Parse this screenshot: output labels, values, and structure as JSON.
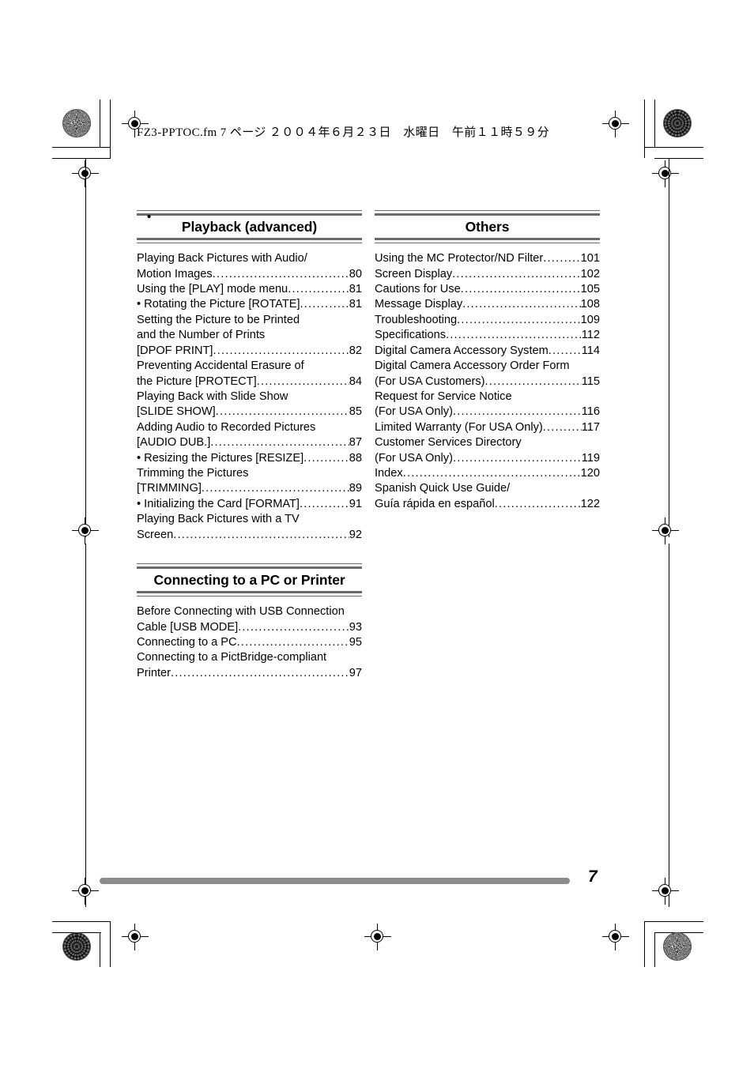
{
  "document": {
    "running_header": "FZ3-PPTOC.fm  7 ページ  ２００４年６月２３日　水曜日　午前１１時５９分",
    "folio": "7"
  },
  "columns": {
    "left": [
      {
        "heading": "Playback (advanced)",
        "entries": [
          {
            "kind": "wrap-start",
            "text": "Playing Back Pictures with Audio/"
          },
          {
            "kind": "entry",
            "indent": "ind",
            "text": "Motion Images",
            "page": "80"
          },
          {
            "kind": "entry",
            "indent": "",
            "text": "Using the [PLAY] mode menu ",
            "page": "81"
          },
          {
            "kind": "entry",
            "indent": "bul",
            "bullet": "•",
            "text": "Rotating the Picture [ROTATE]",
            "page": "81"
          },
          {
            "kind": "wrap-start-bullet",
            "bullet": "•",
            "text": "Setting the Picture to be Printed"
          },
          {
            "kind": "wrap-cont",
            "indent": "bul2",
            "text": "and the Number of Prints"
          },
          {
            "kind": "entry",
            "indent": "bul2",
            "text": "[DPOF PRINT]",
            "page": "82"
          },
          {
            "kind": "wrap-start-bullet",
            "bullet": "•",
            "text": "Preventing Accidental Erasure of"
          },
          {
            "kind": "entry",
            "indent": "bul2",
            "text": "the Picture [PROTECT] ",
            "page": "84"
          },
          {
            "kind": "wrap-start-bullet",
            "bullet": "•",
            "text": "Playing Back with Slide Show"
          },
          {
            "kind": "entry",
            "indent": "bul2",
            "text": "[SLIDE SHOW]",
            "page": "85"
          },
          {
            "kind": "wrap-start-bullet",
            "bullet": "•",
            "text": "Adding Audio to Recorded Pictures"
          },
          {
            "kind": "entry",
            "indent": "bul2",
            "text": "[AUDIO DUB.] ",
            "page": "87"
          },
          {
            "kind": "entry",
            "indent": "bul",
            "bullet": "•",
            "text": "Resizing the Pictures [RESIZE]",
            "page": "88"
          },
          {
            "kind": "wrap-start-bullet",
            "bullet": "•",
            "text": "Trimming the Pictures"
          },
          {
            "kind": "entry",
            "indent": "bul2",
            "text": "[TRIMMING] ",
            "page": "89"
          },
          {
            "kind": "entry",
            "indent": "bul",
            "bullet": "•",
            "text": "Initializing the Card [FORMAT]",
            "page": "91"
          },
          {
            "kind": "wrap-start",
            "text": "Playing Back Pictures with a TV"
          },
          {
            "kind": "entry",
            "indent": "ind",
            "text": "Screen",
            "page": "92"
          }
        ]
      },
      {
        "heading": "Connecting to a PC or Printer",
        "entries": [
          {
            "kind": "wrap-start",
            "text": "Before Connecting with USB Connection"
          },
          {
            "kind": "entry",
            "indent": "ind",
            "text": "Cable [USB MODE]",
            "page": "93"
          },
          {
            "kind": "entry",
            "indent": "",
            "text": "Connecting to a PC",
            "page": "95"
          },
          {
            "kind": "wrap-start",
            "text": "Connecting to a PictBridge-compliant"
          },
          {
            "kind": "entry",
            "indent": "ind",
            "text": "Printer",
            "page": "97"
          }
        ]
      }
    ],
    "right": [
      {
        "heading": "Others",
        "entries": [
          {
            "kind": "entry",
            "indent": "",
            "text": "Using the MC Protector/ND Filter ",
            "page": "101"
          },
          {
            "kind": "entry",
            "indent": "",
            "text": "Screen Display",
            "page": "102"
          },
          {
            "kind": "entry",
            "indent": "",
            "text": "Cautions for Use ",
            "page": "105"
          },
          {
            "kind": "entry",
            "indent": "",
            "text": "Message Display ",
            "page": "108"
          },
          {
            "kind": "entry",
            "indent": "",
            "text": "Troubleshooting ",
            "page": "109"
          },
          {
            "kind": "entry",
            "indent": "",
            "text": "Specifications",
            "page": "112"
          },
          {
            "kind": "entry",
            "indent": "",
            "text": "Digital Camera Accessory System",
            "page": "114"
          },
          {
            "kind": "wrap-start",
            "text": "Digital Camera Accessory Order Form"
          },
          {
            "kind": "entry",
            "indent": "ind",
            "text": "(For USA Customers)",
            "page": "115"
          },
          {
            "kind": "wrap-start",
            "text": "Request for Service Notice"
          },
          {
            "kind": "entry",
            "indent": "ind",
            "text": "(For USA Only)",
            "page": "116"
          },
          {
            "kind": "entry",
            "indent": "",
            "text": "Limited Warranty (For USA Only) ",
            "page": "117"
          },
          {
            "kind": "wrap-start",
            "text": "Customer Services Directory"
          },
          {
            "kind": "entry",
            "indent": "ind",
            "text": "(For USA Only)",
            "page": "119"
          },
          {
            "kind": "entry",
            "indent": "",
            "text": "Index ",
            "page": "120"
          },
          {
            "kind": "wrap-start",
            "text": "Spanish Quick Use Guide/"
          },
          {
            "kind": "entry",
            "indent": "ind",
            "text": "Guía rápida en español",
            "page": "122"
          }
        ]
      }
    ]
  },
  "marks": {
    "registration_target": "registration-target-mark",
    "starburst": "starburst-density-mark",
    "knot": "knot-density-mark",
    "crop_lines": "crop-trim-lines"
  },
  "colors": {
    "rule": "#6a6a6a",
    "footer_bar": "#8c8c8c",
    "text": "#000000"
  }
}
